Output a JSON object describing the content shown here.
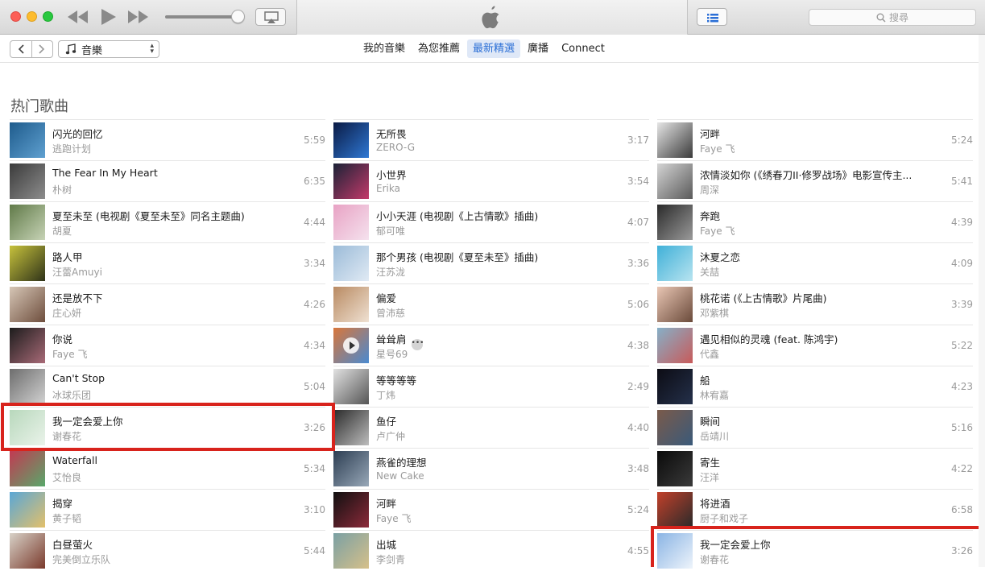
{
  "window": {
    "search_placeholder": "搜尋",
    "media_kind": "音樂"
  },
  "nav": {
    "tabs": [
      "我的音樂",
      "為您推薦",
      "最新精選",
      "廣播",
      "Connect"
    ],
    "active_tab": "最新精選"
  },
  "section": {
    "title": "热门歌曲"
  },
  "columns": [
    [
      {
        "title": "闪光的回忆",
        "artist": "逃跑计划",
        "duration": "5:59",
        "art": [
          "#1e5b8c",
          "#5fa0d0"
        ]
      },
      {
        "title": "The Fear In My Heart",
        "artist": "朴树",
        "duration": "6:35",
        "art": [
          "#3b3b3b",
          "#8d8d8d"
        ]
      },
      {
        "title": "夏至未至 (电视剧《夏至未至》同名主题曲)",
        "artist": "胡夏",
        "duration": "4:44",
        "art": [
          "#607a48",
          "#c7d3b6"
        ]
      },
      {
        "title": "路人甲",
        "artist": "汪蕾Amuyi",
        "duration": "3:34",
        "art": [
          "#c7c23c",
          "#2f3319"
        ]
      },
      {
        "title": "还是放不下",
        "artist": "庄心妍",
        "duration": "4:26",
        "art": [
          "#d6c6b6",
          "#6e4e3d"
        ]
      },
      {
        "title": "你说",
        "artist": "Faye 飞",
        "duration": "4:34",
        "art": [
          "#1c1c1c",
          "#a86a77"
        ]
      },
      {
        "title": "Can't Stop",
        "artist": "冰球乐团",
        "duration": "5:04",
        "art": [
          "#6d6d6d",
          "#d2d2d2"
        ]
      },
      {
        "title": "我一定会爱上你",
        "artist": "谢春花",
        "duration": "3:26",
        "art": [
          "#b8d8bc",
          "#eaf3ea"
        ]
      },
      {
        "title": "Waterfall",
        "artist": "艾怡良",
        "duration": "5:34",
        "art": [
          "#c23a52",
          "#58a86a"
        ]
      },
      {
        "title": "揭穿",
        "artist": "黄子韬",
        "duration": "3:10",
        "art": [
          "#5aa7d6",
          "#e3c06a"
        ]
      },
      {
        "title": "白昼萤火",
        "artist": "完美倒立乐队",
        "duration": "5:44",
        "art": [
          "#d8d2c8",
          "#7a3a2c"
        ]
      }
    ],
    [
      {
        "title": "无所畏",
        "artist": "ZERO-G",
        "duration": "3:17",
        "art": [
          "#0a1a44",
          "#2f78d4"
        ]
      },
      {
        "title": "小世界",
        "artist": "Erika",
        "duration": "3:54",
        "art": [
          "#1a2236",
          "#c33a6a"
        ]
      },
      {
        "title": "小小天涯 (电视剧《上古情歌》插曲)",
        "artist": "郁可唯",
        "duration": "4:07",
        "art": [
          "#e8a2c4",
          "#f5e2ee"
        ]
      },
      {
        "title": "那个男孩 (电视剧《夏至未至》插曲)",
        "artist": "汪苏泷",
        "duration": "3:36",
        "art": [
          "#9bbbd8",
          "#e0eaf4"
        ]
      },
      {
        "title": "偏爱",
        "artist": "曾沛慈",
        "duration": "5:06",
        "art": [
          "#b98a62",
          "#efe1d2"
        ]
      },
      {
        "title": "耸耸肩",
        "artist": "星号69",
        "duration": "4:38",
        "art": [
          "#d9763a",
          "#4a8ad0"
        ],
        "more": true,
        "play": true
      },
      {
        "title": "等等等等",
        "artist": "丁炜",
        "duration": "2:49",
        "art": [
          "#e2e2e2",
          "#555555"
        ]
      },
      {
        "title": "鱼仔",
        "artist": "卢广仲",
        "duration": "4:40",
        "art": [
          "#2a2a2a",
          "#bdbdbd"
        ]
      },
      {
        "title": "燕雀的理想",
        "artist": "New Cake",
        "duration": "3:48",
        "art": [
          "#2c3d52",
          "#98a8b8"
        ]
      },
      {
        "title": "河畔",
        "artist": "Faye 飞",
        "duration": "5:24",
        "art": [
          "#101010",
          "#8c2a3a"
        ]
      },
      {
        "title": "出城",
        "artist": "李剑青",
        "duration": "4:55",
        "art": [
          "#7aa0a4",
          "#d6c08a"
        ]
      }
    ],
    [
      {
        "title": "河畔",
        "artist": "Faye 飞",
        "duration": "5:24",
        "art": [
          "#e6e6e6",
          "#3a3a3a"
        ]
      },
      {
        "title": "浓情淡如你 (《绣春刀II·修罗战场》电影宣传主...",
        "artist": "周深",
        "duration": "5:41",
        "art": [
          "#d4d4d4",
          "#5a5a5a"
        ]
      },
      {
        "title": "奔跑",
        "artist": "Faye 飞",
        "duration": "4:39",
        "art": [
          "#2a2a2a",
          "#9a9a9a"
        ]
      },
      {
        "title": "沐夏之恋",
        "artist": "关喆",
        "duration": "4:09",
        "art": [
          "#3fb0d8",
          "#b8e4f0"
        ]
      },
      {
        "title": "桃花诺 (《上古情歌》片尾曲)",
        "artist": "邓紫棋",
        "duration": "3:39",
        "art": [
          "#e9c6b4",
          "#6a4a3a"
        ]
      },
      {
        "title": "遇见相似的灵魂 (feat. 陈鸿宇)",
        "artist": "代鑫",
        "duration": "5:22",
        "art": [
          "#86b0c8",
          "#c85a5a"
        ]
      },
      {
        "title": "船",
        "artist": "林宥嘉",
        "duration": "4:23",
        "art": [
          "#0c0c14",
          "#24304a"
        ]
      },
      {
        "title": "瞬间",
        "artist": "岳靖川",
        "duration": "5:16",
        "art": [
          "#7a5a4a",
          "#3a5a7a"
        ]
      },
      {
        "title": "寄生",
        "artist": "汪洋",
        "duration": "4:22",
        "art": [
          "#0a0a0a",
          "#3a3a3a"
        ]
      },
      {
        "title": "将进酒",
        "artist": "厨子和戏子",
        "duration": "6:58",
        "art": [
          "#c2402a",
          "#2a2a2a"
        ]
      },
      {
        "title": "我一定会爱上你",
        "artist": "谢春花",
        "duration": "3:26",
        "art": [
          "#8ab4e4",
          "#eef4fb"
        ]
      }
    ]
  ]
}
